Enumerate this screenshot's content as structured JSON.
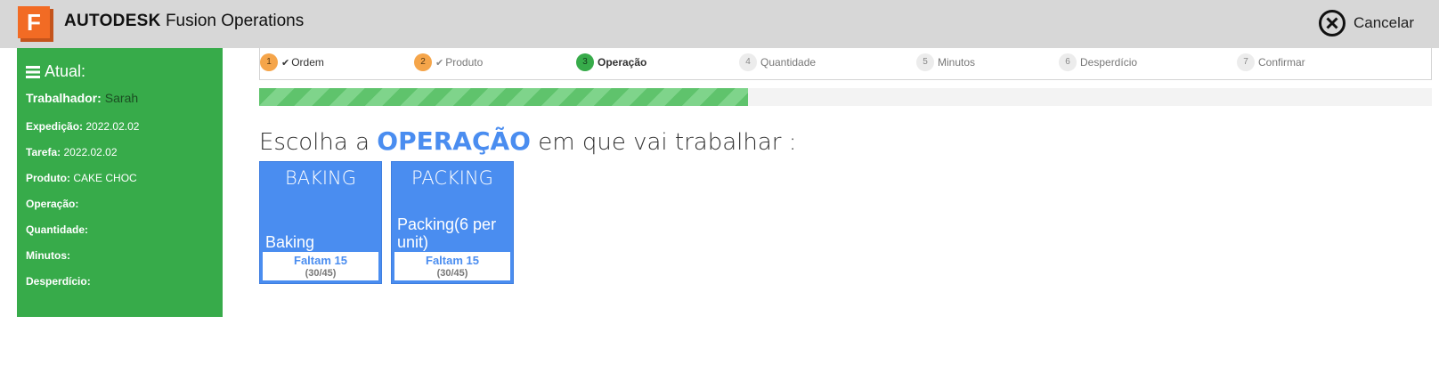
{
  "header": {
    "logo_letter": "F",
    "brand_strong": "AUTODESK",
    "brand_rest": "Fusion Operations",
    "cancel_label": "Cancelar",
    "cancel_icon": "close-circle-icon",
    "colors": {
      "bar": "#d7d7d7",
      "logo": "#f26b24"
    }
  },
  "sidebar": {
    "title": "Atual:",
    "title_icon": "hamburger-icon",
    "worker_label": "Trabalhador:",
    "worker_value": "Sarah",
    "rows": [
      {
        "label": "Expedição:",
        "value": "2022.02.02"
      },
      {
        "label": "Tarefa:",
        "value": "2022.02.02"
      },
      {
        "label": "Produto:",
        "value": "CAKE CHOC"
      },
      {
        "label": "Operação:",
        "value": ""
      },
      {
        "label": "Quantidade:",
        "value": ""
      },
      {
        "label": "Minutos:",
        "value": ""
      },
      {
        "label": "Desperdício:",
        "value": ""
      }
    ],
    "color": "#37ab4a"
  },
  "stepper": {
    "steps": [
      {
        "num": "1",
        "label": "Ordem",
        "state": "done"
      },
      {
        "num": "2",
        "label": "Produto",
        "state": "done"
      },
      {
        "num": "3",
        "label": "Operação",
        "state": "active"
      },
      {
        "num": "4",
        "label": "Quantidade",
        "state": "todo"
      },
      {
        "num": "5",
        "label": "Minutos",
        "state": "todo"
      },
      {
        "num": "6",
        "label": "Desperdício",
        "state": "todo"
      },
      {
        "num": "7",
        "label": "Confirmar",
        "state": "todo"
      }
    ]
  },
  "progress": {
    "fraction": 0.4165
  },
  "heading": {
    "prefix": "Escolha a ",
    "accent": "OPERAÇÃO",
    "suffix": " em que vai trabalhar :"
  },
  "operations": [
    {
      "code": "BAKING",
      "desc": "Baking",
      "remaining": "Faltam 15",
      "ratio": "(30/45)"
    },
    {
      "code": "PACKING",
      "desc": "Packing(6 per unit)",
      "remaining": "Faltam 15",
      "ratio": "(30/45)"
    }
  ]
}
